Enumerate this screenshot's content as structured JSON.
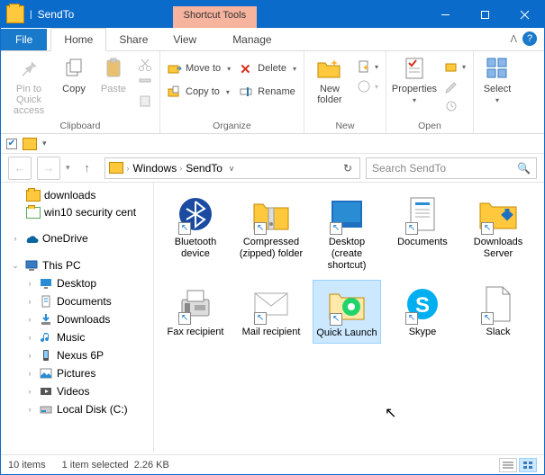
{
  "window": {
    "title": "SendTo",
    "context_tab": "Shortcut Tools"
  },
  "tabs": {
    "file": "File",
    "home": "Home",
    "share": "Share",
    "view": "View",
    "manage": "Manage"
  },
  "ribbon": {
    "clipboard": {
      "label": "Clipboard",
      "pin": "Pin to Quick access",
      "copy": "Copy",
      "paste": "Paste"
    },
    "organize": {
      "label": "Organize",
      "move": "Move to",
      "copy": "Copy to",
      "delete": "Delete",
      "rename": "Rename"
    },
    "new": {
      "label": "New",
      "newfolder": "New folder"
    },
    "open": {
      "label": "Open",
      "properties": "Properties"
    },
    "select": {
      "label": "Select"
    }
  },
  "breadcrumb": {
    "seg1": "Windows",
    "seg2": "SendTo"
  },
  "search": {
    "placeholder": "Search SendTo"
  },
  "tree": {
    "downloads": "downloads",
    "win10": "win10 security cent",
    "onedrive": "OneDrive",
    "thispc": "This PC",
    "desktop": "Desktop",
    "documents": "Documents",
    "t_downloads": "Downloads",
    "music": "Music",
    "nexus": "Nexus 6P",
    "pictures": "Pictures",
    "videos": "Videos",
    "localdisk": "Local Disk (C:)"
  },
  "items": {
    "bluetooth": "Bluetooth device",
    "compressed": "Compressed (zipped) folder",
    "desktop": "Desktop (create shortcut)",
    "documents": "Documents",
    "dlserver": "Downloads Server",
    "fax": "Fax recipient",
    "mail": "Mail recipient",
    "quick": "Quick Launch",
    "skype": "Skype",
    "slack": "Slack"
  },
  "status": {
    "count": "10 items",
    "selection": "1 item selected",
    "size": "2.26 KB"
  }
}
